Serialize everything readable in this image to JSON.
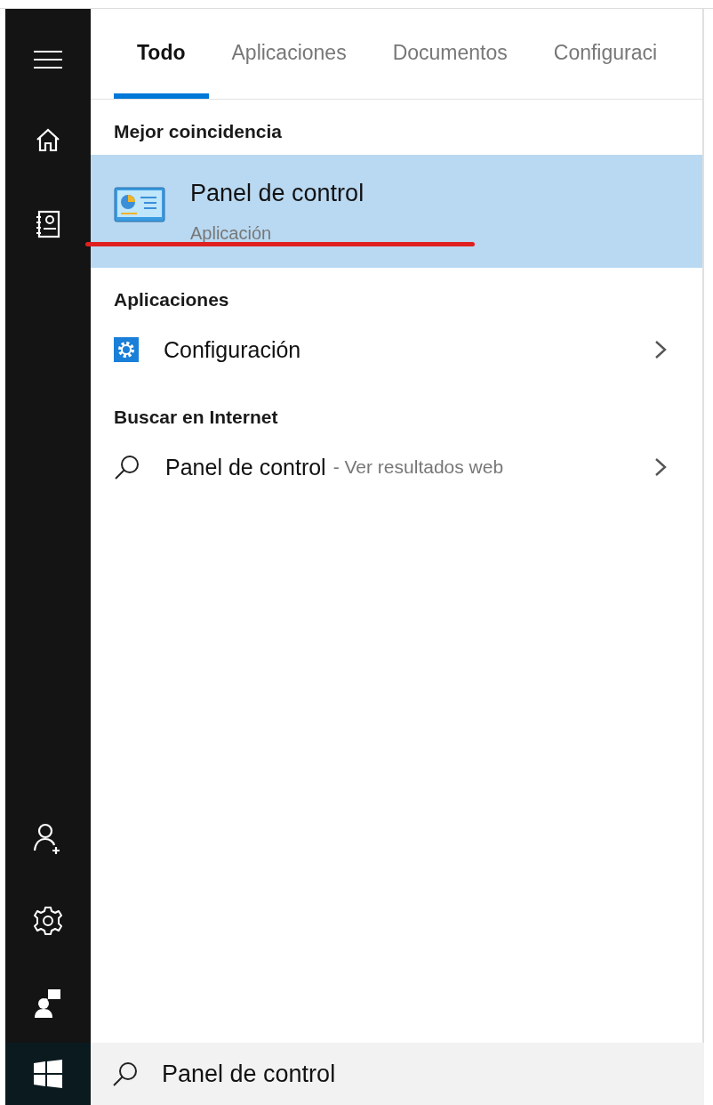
{
  "tabs": [
    {
      "label": "Todo",
      "selected": true
    },
    {
      "label": "Aplicaciones",
      "selected": false
    },
    {
      "label": "Documentos",
      "selected": false
    },
    {
      "label": "Configuraci",
      "selected": false
    }
  ],
  "best_match": {
    "heading": "Mejor coincidencia",
    "title": "Panel de control",
    "subtitle": "Aplicación",
    "selected": true
  },
  "sections": [
    {
      "heading": "Aplicaciones",
      "items": [
        {
          "kind": "app",
          "label": "Configuración"
        }
      ]
    },
    {
      "heading": "Buscar en Internet",
      "items": [
        {
          "kind": "web",
          "label": "Panel de control",
          "hint": "- Ver resultados web"
        }
      ]
    }
  ],
  "search": {
    "value": "Panel de control"
  }
}
